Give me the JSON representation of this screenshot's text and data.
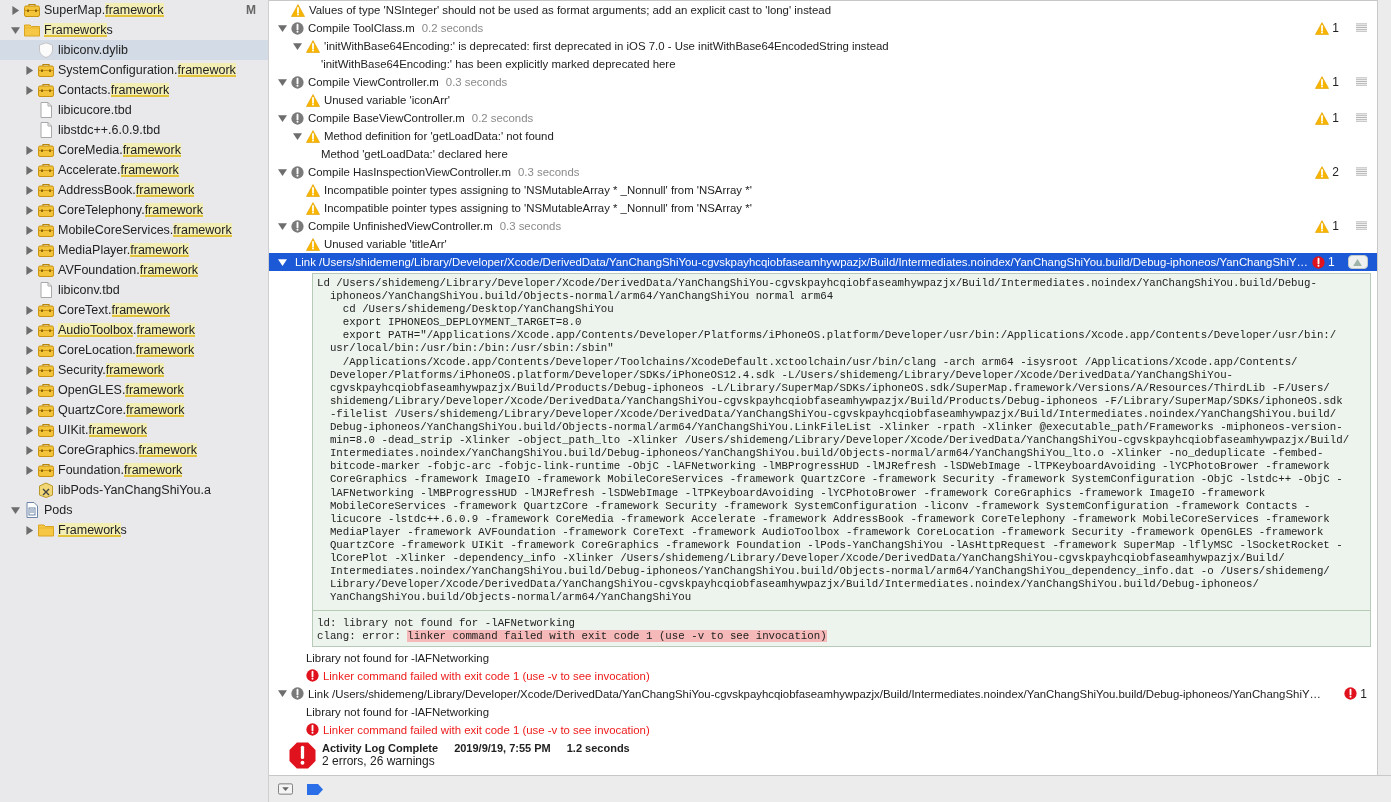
{
  "sidebar": {
    "items": [
      {
        "kind": "framework",
        "segments": [
          {
            "text": "SuperMap.",
            "highlight": false
          },
          {
            "text": "framework",
            "highlight": true
          }
        ],
        "expanded": false,
        "selected": false,
        "badge": "M"
      },
      {
        "kind": "folder",
        "segments": [
          {
            "text": "Framework",
            "highlight": true
          },
          {
            "text": "s",
            "highlight": false
          }
        ],
        "expanded": true,
        "selected": false,
        "children": [
          {
            "kind": "dylib",
            "segments": [
              {
                "text": "libiconv.dylib",
                "highlight": false
              }
            ],
            "selected": true
          },
          {
            "kind": "framework",
            "segments": [
              {
                "text": "SystemConfiguration.",
                "highlight": false
              },
              {
                "text": "framework",
                "highlight": true
              }
            ],
            "expanded": false,
            "selected": false
          },
          {
            "kind": "framework",
            "segments": [
              {
                "text": "Contacts.",
                "highlight": false
              },
              {
                "text": "framework",
                "highlight": true
              }
            ],
            "expanded": false,
            "selected": false
          },
          {
            "kind": "file",
            "segments": [
              {
                "text": "libicucore.tbd",
                "highlight": false
              }
            ],
            "selected": false
          },
          {
            "kind": "file",
            "segments": [
              {
                "text": "libstdc++.6.0.9.tbd",
                "highlight": false
              }
            ],
            "selected": false
          },
          {
            "kind": "framework",
            "segments": [
              {
                "text": "CoreMedia.",
                "highlight": false
              },
              {
                "text": "framework",
                "highlight": true
              }
            ],
            "expanded": false,
            "selected": false
          },
          {
            "kind": "framework",
            "segments": [
              {
                "text": "Accelerate.",
                "highlight": false
              },
              {
                "text": "framework",
                "highlight": true
              }
            ],
            "expanded": false,
            "selected": false
          },
          {
            "kind": "framework",
            "segments": [
              {
                "text": "AddressBook.",
                "highlight": false
              },
              {
                "text": "framework",
                "highlight": true
              }
            ],
            "expanded": false,
            "selected": false
          },
          {
            "kind": "framework",
            "segments": [
              {
                "text": "CoreTelephony.",
                "highlight": false
              },
              {
                "text": "framework",
                "highlight": true
              }
            ],
            "expanded": false,
            "selected": false
          },
          {
            "kind": "framework",
            "segments": [
              {
                "text": "MobileCoreServices.",
                "highlight": false
              },
              {
                "text": "framework",
                "highlight": true
              }
            ],
            "expanded": false,
            "selected": false
          },
          {
            "kind": "framework",
            "segments": [
              {
                "text": "MediaPlayer.",
                "highlight": false
              },
              {
                "text": "framework",
                "highlight": true
              }
            ],
            "expanded": false,
            "selected": false
          },
          {
            "kind": "framework",
            "segments": [
              {
                "text": "AVFoundation.",
                "highlight": false
              },
              {
                "text": "framework",
                "highlight": true
              }
            ],
            "expanded": false,
            "selected": false
          },
          {
            "kind": "file",
            "segments": [
              {
                "text": "libiconv.tbd",
                "highlight": false
              }
            ],
            "selected": false
          },
          {
            "kind": "framework",
            "segments": [
              {
                "text": "CoreText.",
                "highlight": false
              },
              {
                "text": "framework",
                "highlight": true
              }
            ],
            "expanded": false,
            "selected": false
          },
          {
            "kind": "framework",
            "segments": [
              {
                "text": "AudioToolbox",
                "highlight": true
              },
              {
                "text": ".",
                "highlight": false
              },
              {
                "text": "framework",
                "highlight": true
              }
            ],
            "expanded": false,
            "selected": false
          },
          {
            "kind": "framework",
            "segments": [
              {
                "text": "CoreLocation.",
                "highlight": false
              },
              {
                "text": "framework",
                "highlight": true
              }
            ],
            "expanded": false,
            "selected": false
          },
          {
            "kind": "framework",
            "segments": [
              {
                "text": "Security.",
                "highlight": false
              },
              {
                "text": "framework",
                "highlight": true
              }
            ],
            "expanded": false,
            "selected": false
          },
          {
            "kind": "framework",
            "segments": [
              {
                "text": "OpenGLES.",
                "highlight": false
              },
              {
                "text": "framework",
                "highlight": true
              }
            ],
            "expanded": false,
            "selected": false
          },
          {
            "kind": "framework",
            "segments": [
              {
                "text": "QuartzCore.",
                "highlight": false
              },
              {
                "text": "framework",
                "highlight": true
              }
            ],
            "expanded": false,
            "selected": false
          },
          {
            "kind": "framework",
            "segments": [
              {
                "text": "UIKit.",
                "highlight": false
              },
              {
                "text": "framework",
                "highlight": true
              }
            ],
            "expanded": false,
            "selected": false
          },
          {
            "kind": "framework",
            "segments": [
              {
                "text": "CoreGraphics.",
                "highlight": false
              },
              {
                "text": "framework",
                "highlight": true
              }
            ],
            "expanded": false,
            "selected": false
          },
          {
            "kind": "framework",
            "segments": [
              {
                "text": "Foundation.",
                "highlight": false
              },
              {
                "text": "framework",
                "highlight": true
              }
            ],
            "expanded": false,
            "selected": false
          },
          {
            "kind": "library",
            "segments": [
              {
                "text": "libPods-YanChangShiYou.a",
                "highlight": false
              }
            ],
            "selected": false
          }
        ]
      },
      {
        "kind": "project",
        "segments": [
          {
            "text": "Pods",
            "highlight": false
          }
        ],
        "expanded": true,
        "selected": false,
        "children": [
          {
            "kind": "folder",
            "segments": [
              {
                "text": "Framework",
                "highlight": true
              },
              {
                "text": "s",
                "highlight": false
              }
            ],
            "expanded": false,
            "selected": false
          }
        ]
      }
    ]
  },
  "log": [
    {
      "kind": "warning",
      "text": "Values of type 'NSInteger' should not be used as format arguments; add an explicit cast to 'long' instead"
    },
    {
      "kind": "step",
      "title": "Compile ToolClass.m",
      "duration": "0.2 seconds",
      "expanded": true,
      "selected": false,
      "badge": {
        "kind": "warning",
        "count": "1"
      },
      "children": [
        {
          "kind": "warning",
          "text": "'initWithBase64Encoding:' is deprecated: first deprecated in iOS 7.0 - Use initWithBase64EncodedString instead",
          "expanded": true,
          "children": [
            {
              "kind": "note",
              "text": "'initWithBase64Encoding:' has been explicitly marked deprecated here"
            }
          ]
        }
      ]
    },
    {
      "kind": "step",
      "title": "Compile ViewController.m",
      "duration": "0.3 seconds",
      "expanded": true,
      "selected": false,
      "badge": {
        "kind": "warning",
        "count": "1"
      },
      "children": [
        {
          "kind": "warning",
          "text": "Unused variable 'iconArr'"
        }
      ]
    },
    {
      "kind": "step",
      "title": "Compile BaseViewController.m",
      "duration": "0.2 seconds",
      "expanded": true,
      "selected": false,
      "badge": {
        "kind": "warning",
        "count": "1"
      },
      "children": [
        {
          "kind": "warning",
          "text": "Method definition for 'getLoadData:' not found",
          "expanded": true,
          "children": [
            {
              "kind": "note",
              "text": "Method 'getLoadData:' declared here"
            }
          ]
        }
      ]
    },
    {
      "kind": "step",
      "title": "Compile HasInspectionViewController.m",
      "duration": "0.3 seconds",
      "expanded": true,
      "selected": false,
      "badge": {
        "kind": "warning",
        "count": "2"
      },
      "children": [
        {
          "kind": "warning",
          "text": "Incompatible pointer types assigning to 'NSMutableArray * _Nonnull' from 'NSArray *'"
        },
        {
          "kind": "warning",
          "text": "Incompatible pointer types assigning to 'NSMutableArray * _Nonnull' from 'NSArray *'"
        }
      ]
    },
    {
      "kind": "step",
      "title": "Compile UnfinishedViewController.m",
      "duration": "0.3 seconds",
      "expanded": true,
      "selected": false,
      "badge": {
        "kind": "warning",
        "count": "1"
      },
      "children": [
        {
          "kind": "warning",
          "text": "Unused variable 'titleArr'"
        }
      ]
    },
    {
      "kind": "step",
      "title": "Link /Users/shidemeng/Library/Developer/Xcode/DerivedData/YanChangShiYou-cgvskpayhcqiobfaseamhywpazjx/Build/Intermediates.noindex/YanChangShiYou.build/Debug-iphoneos/YanChangShiY…",
      "expanded": true,
      "selected": true,
      "badge": {
        "kind": "error",
        "count": "1"
      },
      "children": [
        {
          "kind": "transcript",
          "lines": [
            "Ld /Users/shidemeng/Library/Developer/Xcode/DerivedData/YanChangShiYou-cgvskpayhcqiobfaseamhywpazjx/Build/Intermediates.noindex/YanChangShiYou.build/Debug-",
            "  iphoneos/YanChangShiYou.build/Objects-normal/arm64/YanChangShiYou normal arm64",
            "    cd /Users/shidemeng/Desktop/YanChangShiYou",
            "    export IPHONEOS_DEPLOYMENT_TARGET=8.0",
            "    export PATH=\"/Applications/Xcode.app/Contents/Developer/Platforms/iPhoneOS.platform/Developer/usr/bin:/Applications/Xcode.app/Contents/Developer/usr/bin:/",
            "  usr/local/bin:/usr/bin:/bin:/usr/sbin:/sbin\"",
            "    /Applications/Xcode.app/Contents/Developer/Toolchains/XcodeDefault.xctoolchain/usr/bin/clang -arch arm64 -isysroot /Applications/Xcode.app/Contents/",
            "  Developer/Platforms/iPhoneOS.platform/Developer/SDKs/iPhoneOS12.4.sdk -L/Users/shidemeng/Library/Developer/Xcode/DerivedData/YanChangShiYou-",
            "  cgvskpayhcqiobfaseamhywpazjx/Build/Products/Debug-iphoneos -L/Library/SuperMap/SDKs/iphoneOS.sdk/SuperMap.framework/Versions/A/Resources/ThirdLib -F/Users/",
            "  shidemeng/Library/Developer/Xcode/DerivedData/YanChangShiYou-cgvskpayhcqiobfaseamhywpazjx/Build/Products/Debug-iphoneos -F/Library/SuperMap/SDKs/iphoneOS.sdk",
            "  -filelist /Users/shidemeng/Library/Developer/Xcode/DerivedData/YanChangShiYou-cgvskpayhcqiobfaseamhywpazjx/Build/Intermediates.noindex/YanChangShiYou.build/",
            "  Debug-iphoneos/YanChangShiYou.build/Objects-normal/arm64/YanChangShiYou.LinkFileList -Xlinker -rpath -Xlinker @executable_path/Frameworks -miphoneos-version-",
            "  min=8.0 -dead_strip -Xlinker -object_path_lto -Xlinker /Users/shidemeng/Library/Developer/Xcode/DerivedData/YanChangShiYou-cgvskpayhcqiobfaseamhywpazjx/Build/",
            "  Intermediates.noindex/YanChangShiYou.build/Debug-iphoneos/YanChangShiYou.build/Objects-normal/arm64/YanChangShiYou_lto.o -Xlinker -no_deduplicate -fembed-",
            "  bitcode-marker -fobjc-arc -fobjc-link-runtime -ObjC -lAFNetworking -lMBProgressHUD -lMJRefresh -lSDWebImage -lTPKeyboardAvoiding -lYCPhotoBrower -framework",
            "  CoreGraphics -framework ImageIO -framework MobileCoreServices -framework QuartzCore -framework Security -framework SystemConfiguration -ObjC -lstdc++ -ObjC -",
            "  lAFNetworking -lMBProgressHUD -lMJRefresh -lSDWebImage -lTPKeyboardAvoiding -lYCPhotoBrower -framework CoreGraphics -framework ImageIO -framework",
            "  MobileCoreServices -framework QuartzCore -framework Security -framework SystemConfiguration -liconv -framework SystemConfiguration -framework Contacts -",
            "  licucore -lstdc++.6.0.9 -framework CoreMedia -framework Accelerate -framework AddressBook -framework CoreTelephony -framework MobileCoreServices -framework",
            "  MediaPlayer -framework AVFoundation -framework CoreText -framework AudioToolbox -framework CoreLocation -framework Security -framework OpenGLES -framework",
            "  QuartzCore -framework UIKit -framework CoreGraphics -framework Foundation -lPods-YanChangShiYou -lAsHttpRequest -framework SuperMap -lflyMSC -lSocketRocket -",
            "  lCorePlot -Xlinker -dependency_info -Xlinker /Users/shidemeng/Library/Developer/Xcode/DerivedData/YanChangShiYou-cgvskpayhcqiobfaseamhywpazjx/Build/",
            "  Intermediates.noindex/YanChangShiYou.build/Debug-iphoneos/YanChangShiYou.build/Objects-normal/arm64/YanChangShiYou_dependency_info.dat -o /Users/shidemeng/",
            "  Library/Developer/Xcode/DerivedData/YanChangShiYou-cgvskpayhcqiobfaseamhywpazjx/Build/Intermediates.noindex/YanChangShiYou.build/Debug-iphoneos/",
            "  YanChangShiYou.build/Objects-normal/arm64/YanChangShiYou"
          ],
          "output": [
            {
              "segments": [
                {
                  "text": "ld: library not found for -lAFNetworking",
                  "highlight": false
                }
              ]
            },
            {
              "segments": [
                {
                  "text": "clang: error: ",
                  "highlight": false
                },
                {
                  "text": "linker command failed with exit code 1 (use -v to see invocation)",
                  "highlight": true
                }
              ]
            }
          ]
        },
        {
          "kind": "note",
          "text": "Library not found for -lAFNetworking"
        },
        {
          "kind": "error",
          "text": "Linker command failed with exit code 1 (use -v to see invocation)"
        }
      ]
    },
    {
      "kind": "step",
      "title": "Link /Users/shidemeng/Library/Developer/Xcode/DerivedData/YanChangShiYou-cgvskpayhcqiobfaseamhywpazjx/Build/Intermediates.noindex/YanChangShiYou.build/Debug-iphoneos/YanChangShiY…",
      "expanded": true,
      "selected": false,
      "badge": {
        "kind": "error",
        "count": "1"
      },
      "children": [
        {
          "kind": "note",
          "text": "Library not found for -lAFNetworking"
        },
        {
          "kind": "error",
          "text": "Linker command failed with exit code 1 (use -v to see invocation)"
        }
      ]
    }
  ],
  "summary": {
    "title": "Activity Log Complete",
    "date": "2019/9/19, 7:55 PM",
    "duration": "1.2 seconds",
    "counts": "2 errors, 26 warnings"
  }
}
